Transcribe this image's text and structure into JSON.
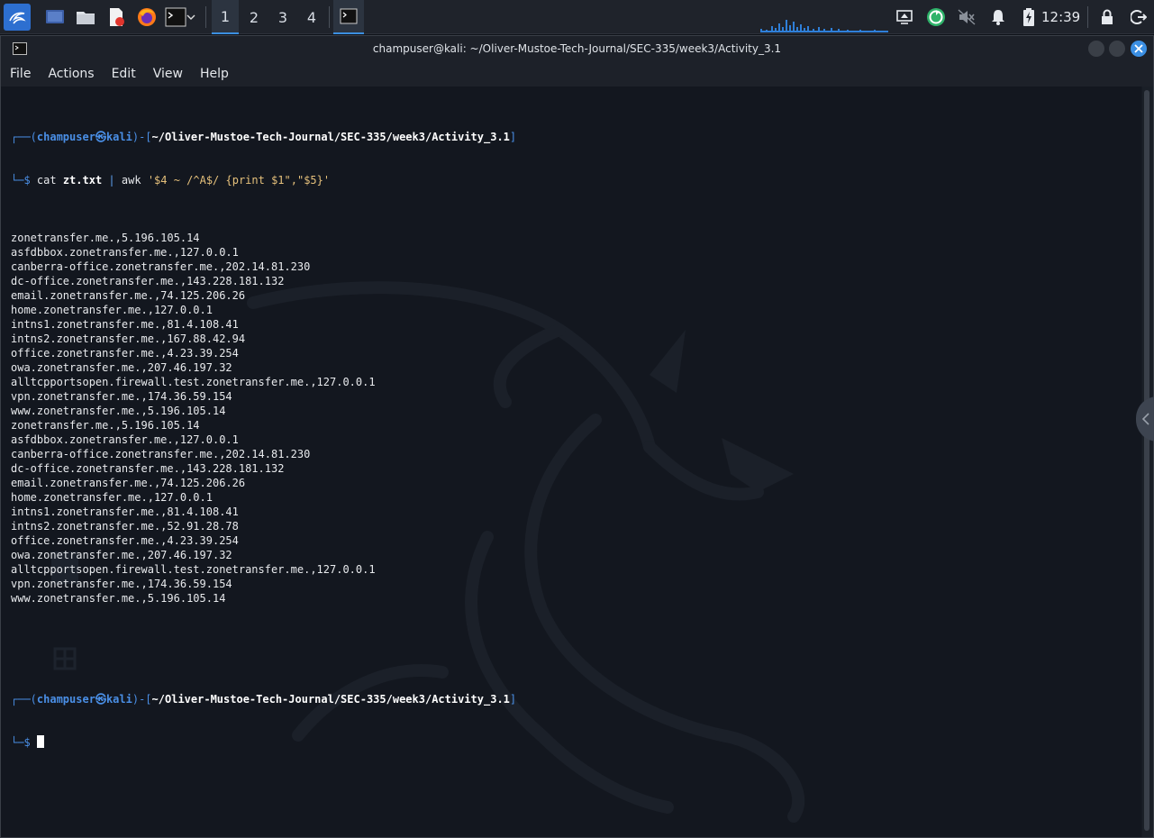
{
  "taskbar": {
    "workspaces": [
      "1",
      "2",
      "3",
      "4"
    ],
    "active_workspace": "1",
    "clock": "12:39",
    "icons": [
      "kali-menu-icon",
      "show-desktop-icon",
      "file-manager-icon",
      "text-editor-icon",
      "firefox-icon",
      "terminal-icon",
      "terminal-task-icon",
      "network-icon",
      "updates-icon",
      "volume-muted-icon",
      "notification-bell-icon",
      "battery-charging-icon",
      "lock-icon",
      "logout-icon"
    ],
    "accent": "#3c8fe0"
  },
  "window": {
    "title": "champuser@kali: ~/Oliver-Mustoe-Tech-Journal/SEC-335/week3/Activity_3.1",
    "menu": [
      "File",
      "Actions",
      "Edit",
      "View",
      "Help"
    ]
  },
  "terminal": {
    "prompt": {
      "user": "champuser",
      "host": "kali",
      "path": "~/Oliver-Mustoe-Tech-Journal/SEC-335/week3/Activity_3.1"
    },
    "command": {
      "cmd": "cat",
      "file": "zt.txt",
      "pipe": "|",
      "prog": "awk",
      "script": "'$4 ~ /^A$/ {print $1\",\"$5}'"
    },
    "output": [
      "zonetransfer.me.,5.196.105.14",
      "asfdbbox.zonetransfer.me.,127.0.0.1",
      "canberra-office.zonetransfer.me.,202.14.81.230",
      "dc-office.zonetransfer.me.,143.228.181.132",
      "email.zonetransfer.me.,74.125.206.26",
      "home.zonetransfer.me.,127.0.0.1",
      "intns1.zonetransfer.me.,81.4.108.41",
      "intns2.zonetransfer.me.,167.88.42.94",
      "office.zonetransfer.me.,4.23.39.254",
      "owa.zonetransfer.me.,207.46.197.32",
      "alltcpportsopen.firewall.test.zonetransfer.me.,127.0.0.1",
      "vpn.zonetransfer.me.,174.36.59.154",
      "www.zonetransfer.me.,5.196.105.14",
      "zonetransfer.me.,5.196.105.14",
      "asfdbbox.zonetransfer.me.,127.0.0.1",
      "canberra-office.zonetransfer.me.,202.14.81.230",
      "dc-office.zonetransfer.me.,143.228.181.132",
      "email.zonetransfer.me.,74.125.206.26",
      "home.zonetransfer.me.,127.0.0.1",
      "intns1.zonetransfer.me.,81.4.108.41",
      "intns2.zonetransfer.me.,52.91.28.78",
      "office.zonetransfer.me.,4.23.39.254",
      "owa.zonetransfer.me.,207.46.197.32",
      "alltcpportsopen.firewall.test.zonetransfer.me.,127.0.0.1",
      "vpn.zonetransfer.me.,174.36.59.154",
      "www.zonetransfer.me.,5.196.105.14"
    ]
  }
}
